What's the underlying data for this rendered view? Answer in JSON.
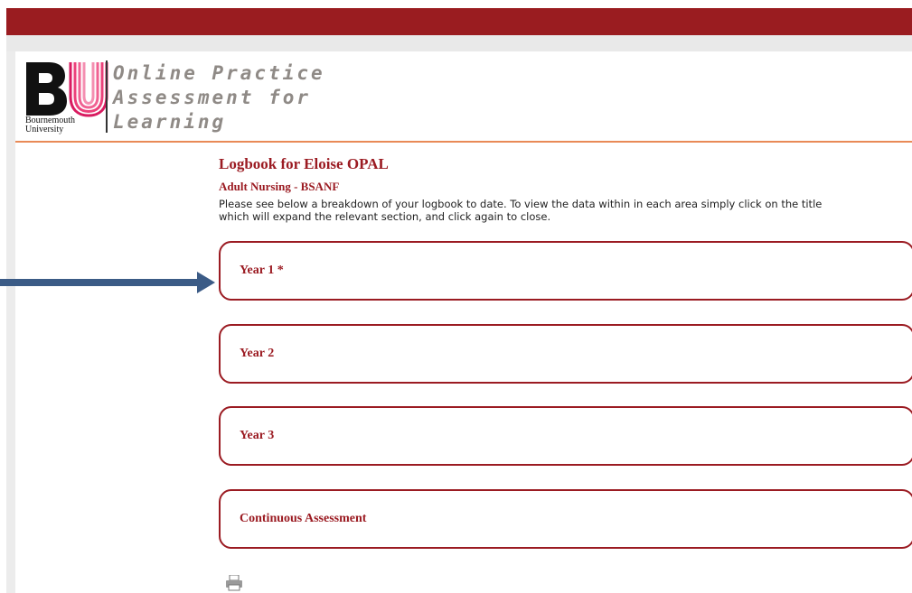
{
  "header": {
    "logo_letters": "BU",
    "logo_caption_line1": "Bournemouth",
    "logo_caption_line2": "University",
    "app_title_line1": "Online Practice",
    "app_title_line2": "Assessment for",
    "app_title_line3": "Learning"
  },
  "logbook": {
    "title": "Logbook for Eloise OPAL",
    "programme": "Adult Nursing - BSANF",
    "intro_line1": "Please see below a breakdown of your logbook to date. To view the data within in each area simply click on the title",
    "intro_line2": "which will expand the relevant section, and click again to close.",
    "sections": [
      {
        "label": "Year 1 *"
      },
      {
        "label": "Year 2"
      },
      {
        "label": "Year 3"
      },
      {
        "label": "Continuous Assessment"
      }
    ]
  },
  "colors": {
    "brand_red": "#9a1c20",
    "accent_orange": "#e98a56",
    "annotation_arrow": "#3b5b86"
  },
  "icons": {
    "print": "printer-icon",
    "arrow": "annotation-arrow-icon"
  }
}
